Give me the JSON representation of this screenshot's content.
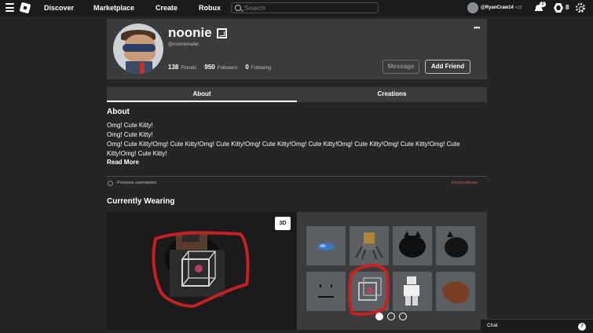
{
  "nav": {
    "links": [
      "Discover",
      "Marketplace",
      "Create",
      "Robux"
    ],
    "search_placeholder": "Search",
    "username": "@RyanCraw14",
    "age_label": "<13",
    "notifications_count": "2",
    "robux_balance": "8"
  },
  "profile": {
    "display_name": "noonie",
    "handle": "@noonieloafer",
    "friends_count": "138",
    "friends_label": "Friends",
    "followers_count": "950",
    "followers_label": "Followers",
    "following_count": "0",
    "following_label": "Following",
    "more_label": "•••",
    "message_label": "Message",
    "add_friend_label": "Add Friend"
  },
  "tabs": [
    {
      "label": "About",
      "active": true
    },
    {
      "label": "Creations",
      "active": false
    }
  ],
  "about": {
    "title": "About",
    "lines": [
      "Omg! Cute Kitty!",
      "Omg! Cute Kitty!",
      "Omg! Cute Kitty!Omg! Cute Kitty!Omg! Cute Kitty!Omg! Cute Kitty!Omg! Cute Kitty!Omg! Cute Kitty!Omg! Cute Kitty!Omg! Cute Kitty!Omg! Cute Kitty!"
    ],
    "read_more": "Read More",
    "previous_usernames": "Previous usernames",
    "report_abuse": "Report Abuse"
  },
  "wearing": {
    "title": "Currently Wearing",
    "view_3d_label": "3D",
    "items": [
      "blue-accessory-item",
      "spider-robot-item",
      "black-hair-item",
      "black-hair-side-item",
      "face-item",
      "cage-item",
      "white-outfit-item",
      "brown-hair-item"
    ],
    "pages": 3,
    "active_page": 0
  },
  "chat": {
    "label": "Chat",
    "count": "7"
  },
  "colors": {
    "background": "#232527",
    "card": "#393b3d",
    "nav": "#191b1d",
    "report": "#e2504a",
    "annotation": "#c8201e"
  }
}
